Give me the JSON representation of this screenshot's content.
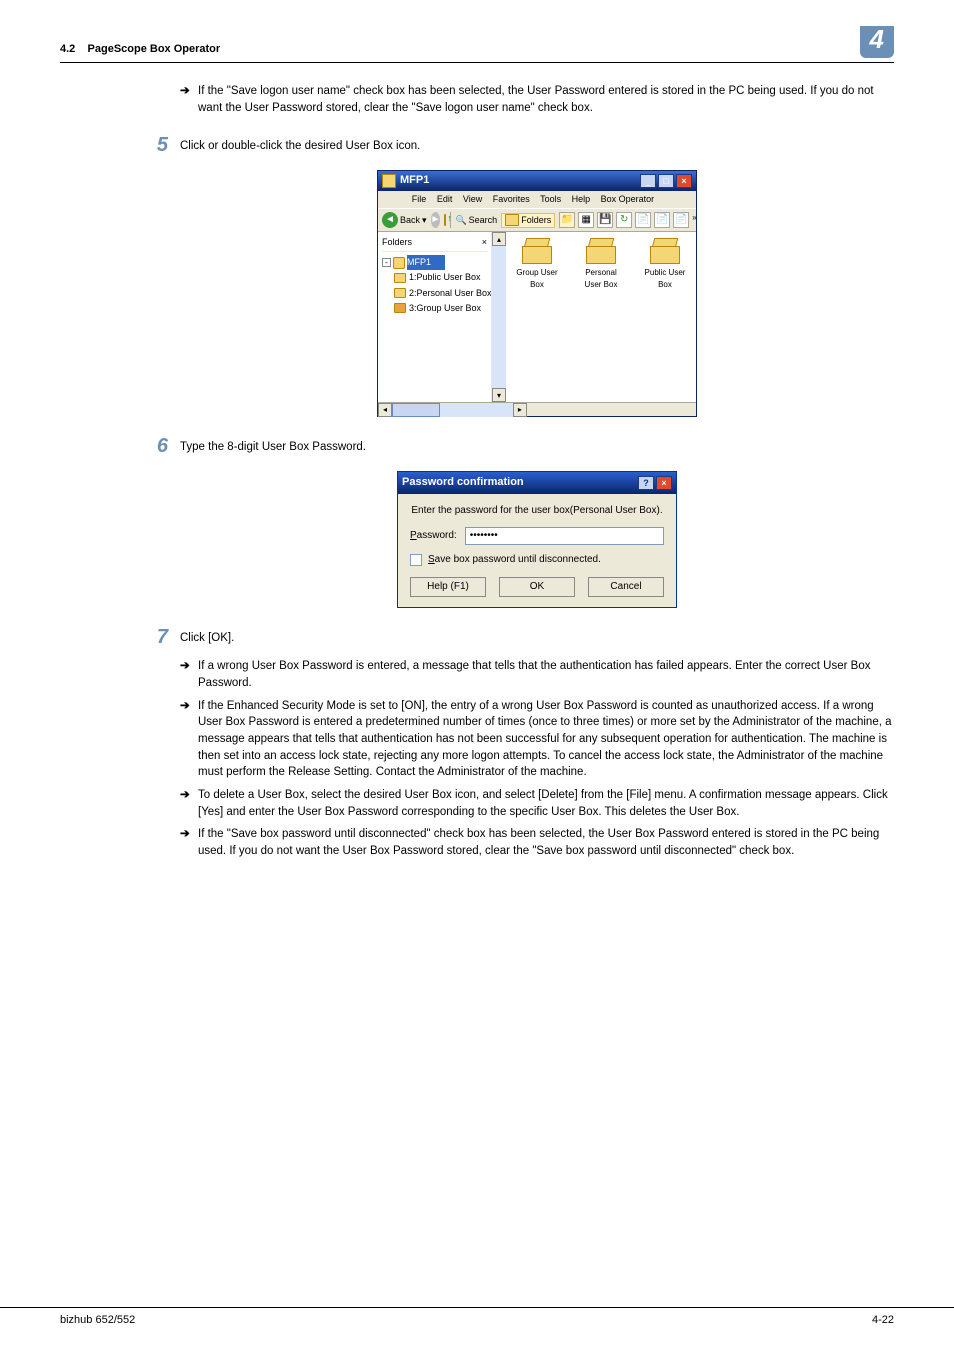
{
  "header": {
    "section_num": "4.2",
    "section_title": "PageScope Box Operator",
    "chapter_num": "4"
  },
  "intro_arrow": "If the \"Save logon user name\" check box has been selected, the User Password entered is stored in the PC being used. If you do not want the User Password stored, clear the \"Save logon user name\" check box.",
  "step5": {
    "num": "5",
    "text": "Click or double-click the desired User Box icon."
  },
  "mfp": {
    "title": "MFP1",
    "menu": [
      "File",
      "Edit",
      "View",
      "Favorites",
      "Tools",
      "Help",
      "Box Operator"
    ],
    "btn_back": "Back",
    "btn_search": "Search",
    "btn_folders": "Folders",
    "tree_header": "Folders",
    "tree_root": "MFP1",
    "tree_items": [
      "1:Public User Box",
      "2:Personal User Box",
      "3:Group User Box"
    ],
    "icons": [
      {
        "label": "Group User Box"
      },
      {
        "label": "Personal User Box"
      },
      {
        "label": "Public User Box"
      }
    ]
  },
  "step6": {
    "num": "6",
    "text": "Type the 8-digit User Box Password."
  },
  "dialog": {
    "title": "Password confirmation",
    "msg": "Enter the password for the user box(Personal User Box).",
    "pw_label_pre": "P",
    "pw_label_rest": "assword:",
    "pw_value": "••••••••",
    "chk_pre": "S",
    "chk_rest": "ave box password until disconnected.",
    "help": "Help (F1)",
    "ok": "OK",
    "cancel": "Cancel"
  },
  "step7": {
    "num": "7",
    "text": "Click [OK]."
  },
  "arrows7": [
    "If a wrong User Box Password is entered, a message that tells that the authentication has failed appears. Enter the correct User Box Password.",
    "If the Enhanced Security Mode is set to [ON], the entry of a wrong User Box Password is counted as unauthorized access. If a wrong User Box Password is entered a predetermined number of times (once to three times) or more set by the Administrator of the machine, a message appears that tells that authentication has not been successful for any subsequent operation for authentication. The machine is then set into an access lock state, rejecting any more logon attempts. To cancel the access lock state, the Administrator of the machine must perform the Release Setting. Contact the Administrator of the machine.",
    "To delete a User Box, select the desired User Box icon, and select [Delete] from the [File] menu. A confirmation message appears. Click [Yes] and enter the User Box Password corresponding to the specific User Box. This deletes the User Box.",
    "If the \"Save box password until disconnected\" check box has been selected, the User Box Password entered is stored in the PC being used. If you do not want the User Box Password stored, clear the \"Save box password until disconnected\" check box."
  ],
  "footer": {
    "product": "bizhub 652/552",
    "page": "4-22"
  }
}
